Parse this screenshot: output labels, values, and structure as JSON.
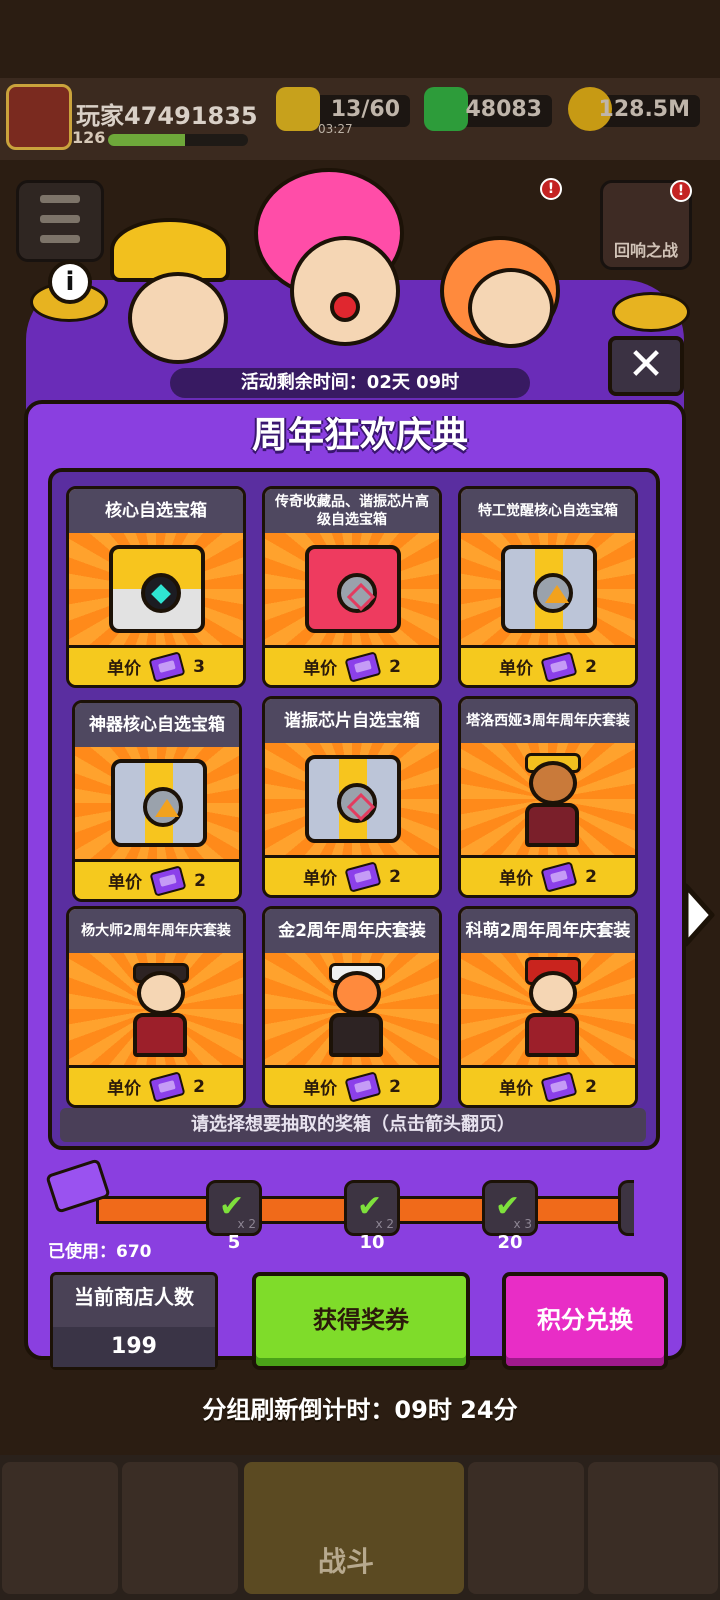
{
  "player": {
    "name": "玩家47491835",
    "level": "126",
    "xp_fraction": 0.55
  },
  "resources": {
    "energy": "13/60",
    "energy_timer": "03:27",
    "gems": "48083",
    "coins": "128.5M"
  },
  "side_buttons": {
    "echo_battle": "回响之战"
  },
  "event": {
    "time_left": "活动剩余时间：02天 09时",
    "title": "周年狂欢庆典",
    "close_symbol": "✕",
    "info_symbol": "i"
  },
  "cards": [
    {
      "name": "核心自选宝箱",
      "price_label": "单价",
      "price": "3",
      "type": "gold-chest"
    },
    {
      "name": "传奇收藏品、谐振芯片高级自选宝箱",
      "price_label": "单价",
      "price": "2",
      "type": "red-chest"
    },
    {
      "name": "特工觉醒核心自选宝箱",
      "price_label": "单价",
      "price": "2",
      "type": "silver-chest"
    },
    {
      "name": "神器核心自选宝箱",
      "price_label": "单价",
      "price": "2",
      "type": "silver-chest"
    },
    {
      "name": "谐振芯片自选宝箱",
      "price_label": "单价",
      "price": "2",
      "type": "silver-chest"
    },
    {
      "name": "塔洛西娅3周年周年庆套装",
      "price_label": "单价",
      "price": "2",
      "type": "hero"
    },
    {
      "name": "杨大师2周年周年庆套装",
      "price_label": "单价",
      "price": "2",
      "type": "hero"
    },
    {
      "name": "金2周年周年庆套装",
      "price_label": "单价",
      "price": "2",
      "type": "hero"
    },
    {
      "name": "科萌2周年周年庆套装",
      "price_label": "单价",
      "price": "2",
      "type": "hero"
    }
  ],
  "hint": "请选择想要抽取的奖箱（点击箭头翻页）",
  "progress": {
    "used": "已使用：670",
    "milestones": [
      {
        "value": "5",
        "multiplier": "x 2"
      },
      {
        "value": "10",
        "multiplier": "x 2"
      },
      {
        "value": "20",
        "multiplier": "x 3"
      }
    ]
  },
  "store": {
    "label": "当前商店人数",
    "count": "199"
  },
  "buttons": {
    "get_ticket": "获得奖券",
    "exchange": "积分兑换"
  },
  "refresh": "分组刷新倒计时：09时 24分",
  "nav": {
    "battle": "战斗"
  },
  "colors": {
    "panel": "#8a3fe0",
    "green_button": "#7fdc2a",
    "pink_button": "#e82dc6",
    "progress": "#f06a1a"
  }
}
